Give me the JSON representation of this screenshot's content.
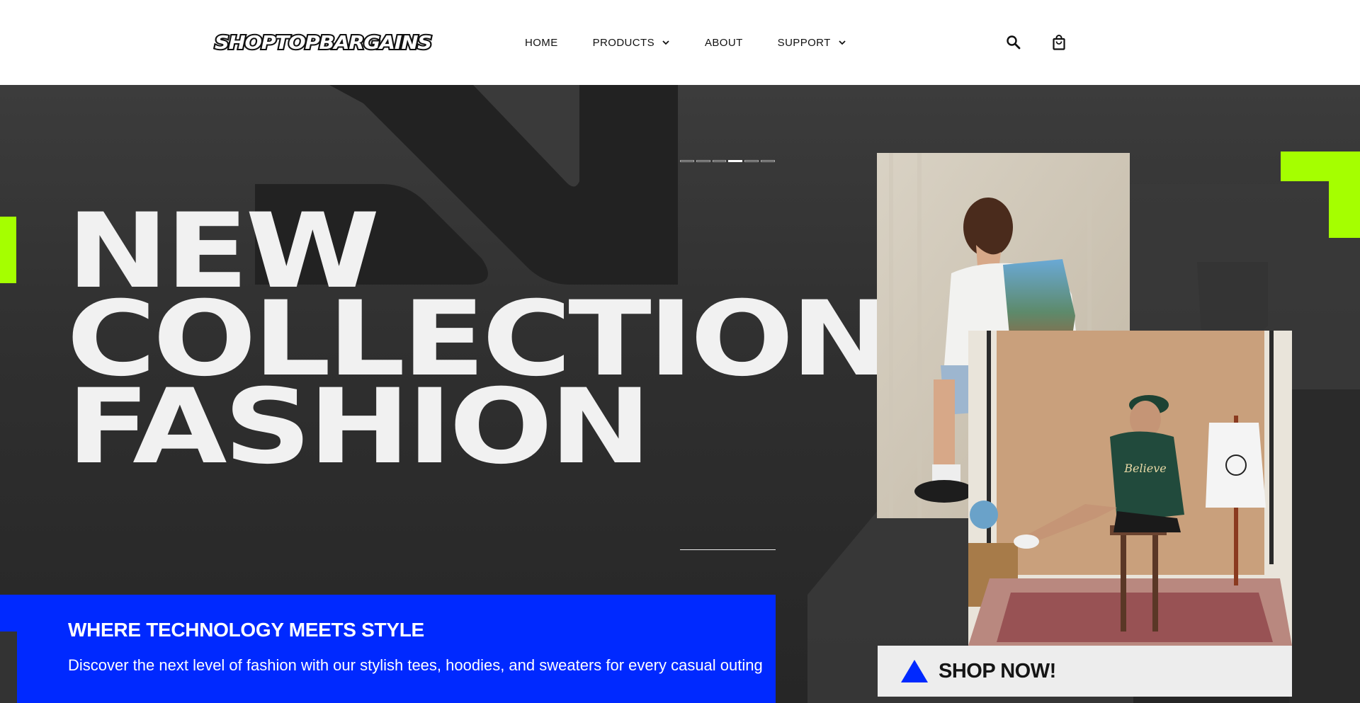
{
  "header": {
    "logo_text": "SHOPTOPBARGAINS",
    "nav": [
      {
        "label": "HOME",
        "has_dropdown": false
      },
      {
        "label": "PRODUCTS",
        "has_dropdown": true
      },
      {
        "label": "ABOUT",
        "has_dropdown": false
      },
      {
        "label": "SUPPORT",
        "has_dropdown": true
      }
    ],
    "icons": {
      "search": "search-icon",
      "cart": "shopping-bag-icon"
    }
  },
  "hero": {
    "headline": [
      "NEW",
      "COLLECTION",
      "FASHION"
    ],
    "slide_indicator": {
      "total": 6,
      "active": 3
    },
    "banner": {
      "title": "WHERE TECHNOLOGY MEETS STYLE",
      "description": "Discover the next level of fashion with our stylish tees, hoodies, and sweaters for every casual outing"
    },
    "cta": {
      "label": "SHOP NOW!",
      "icon": "triangle-icon"
    },
    "images": [
      {
        "name": "model-back-white-tee-photo"
      },
      {
        "name": "model-stool-green-tee-photo"
      }
    ]
  },
  "colors": {
    "accent_lime": "#a5ff00",
    "accent_blue": "#0029ff",
    "hero_bg": "#2b2b2b",
    "headline": "#f1f1f1"
  }
}
